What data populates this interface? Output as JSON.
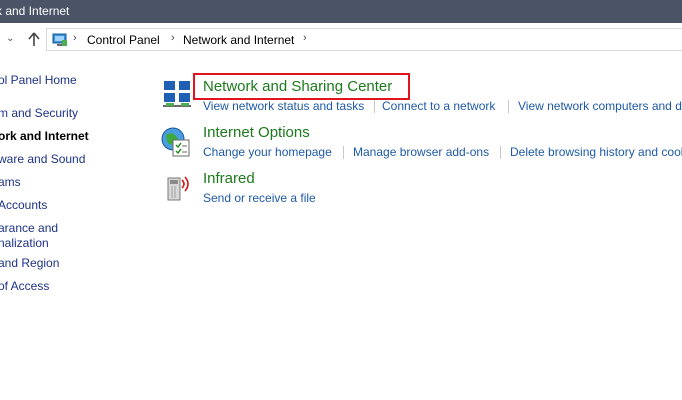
{
  "window": {
    "title": "rk and Internet"
  },
  "address_bar": {
    "crumbs": [
      "Control Panel",
      "Network and Internet"
    ]
  },
  "sidebar": {
    "items": [
      {
        "label": "ol Panel Home"
      },
      {
        "label": "m and Security"
      },
      {
        "label": "ork and Internet"
      },
      {
        "label": "ware and Sound"
      },
      {
        "label": "ams"
      },
      {
        "label": "Accounts"
      },
      {
        "label": "arance and"
      },
      {
        "label": "nalization"
      },
      {
        "label": " and Region"
      },
      {
        "label": "of Access"
      }
    ]
  },
  "categories": [
    {
      "title": "Network and Sharing Center",
      "icon": "network-sharing-icon",
      "tasks": [
        "View network status and tasks",
        "Connect to a network",
        "View network computers and d"
      ]
    },
    {
      "title": "Internet Options",
      "icon": "internet-options-icon",
      "tasks": [
        "Change your homepage",
        "Manage browser add-ons",
        "Delete browsing history and cook"
      ]
    },
    {
      "title": "Infrared",
      "icon": "infrared-icon",
      "tasks": [
        "Send or receive a file"
      ]
    }
  ],
  "colors": {
    "titlebar": "#4a5466",
    "category_title": "#1c7a1c",
    "task_link": "#1e5aa8",
    "highlight_border": "#e0141e"
  }
}
